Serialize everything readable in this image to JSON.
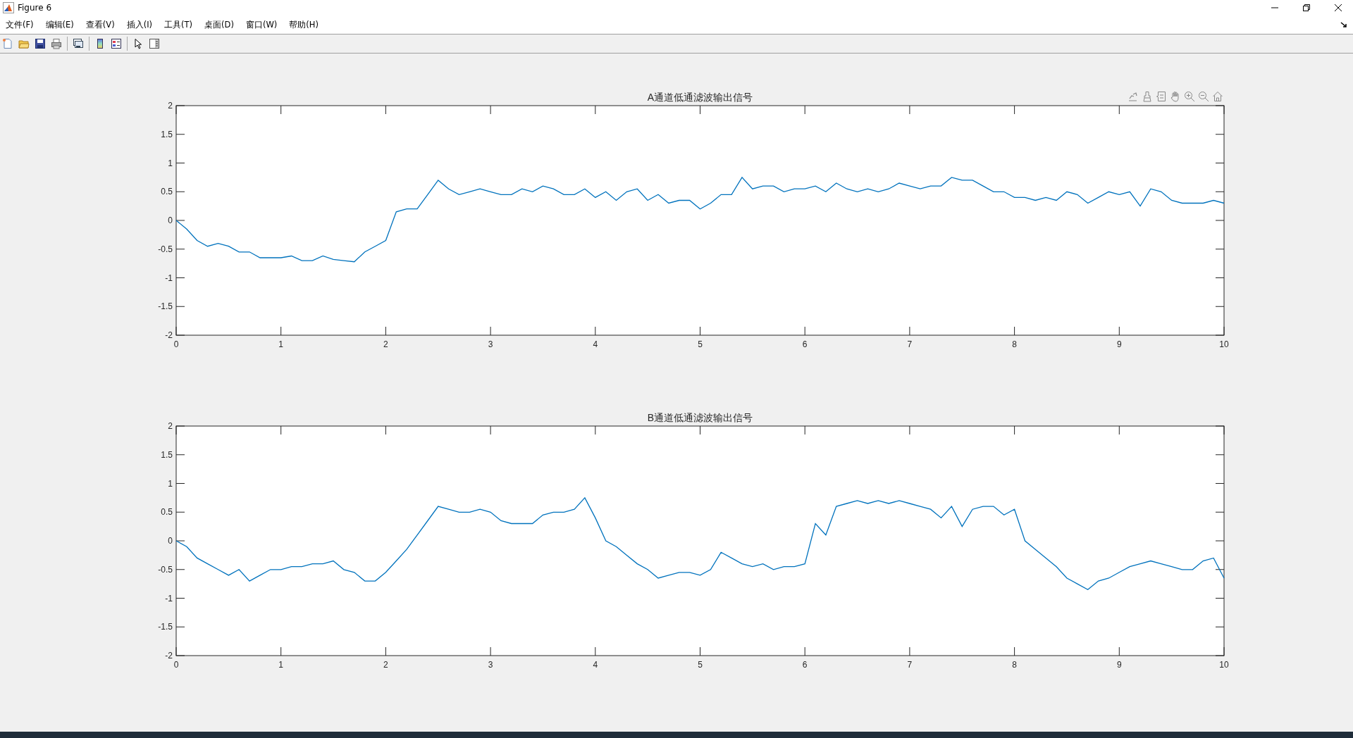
{
  "window": {
    "title": "Figure 6"
  },
  "menu": [
    {
      "label": "文件(F)"
    },
    {
      "label": "编辑(E)"
    },
    {
      "label": "查看(V)"
    },
    {
      "label": "插入(I)"
    },
    {
      "label": "工具(T)"
    },
    {
      "label": "桌面(D)"
    },
    {
      "label": "窗口(W)"
    },
    {
      "label": "帮助(H)"
    }
  ],
  "plots": [
    {
      "chart_data": {
        "type": "line",
        "title": "A通道低通滤波输出信号",
        "xlim": [
          0,
          10
        ],
        "ylim": [
          -2,
          2
        ],
        "xticks": [
          0,
          1,
          2,
          3,
          4,
          5,
          6,
          7,
          8,
          9,
          10
        ],
        "yticks": [
          -2,
          -1.5,
          -1,
          -0.5,
          0,
          0.5,
          1,
          1.5,
          2
        ],
        "x": [
          0,
          0.1,
          0.2,
          0.3,
          0.4,
          0.5,
          0.6,
          0.7,
          0.8,
          0.9,
          1,
          1.1,
          1.2,
          1.3,
          1.4,
          1.5,
          1.6,
          1.7,
          1.8,
          1.9,
          2,
          2.1,
          2.2,
          2.3,
          2.4,
          2.5,
          2.6,
          2.7,
          2.8,
          2.9,
          3,
          3.1,
          3.2,
          3.3,
          3.4,
          3.5,
          3.6,
          3.7,
          3.8,
          3.9,
          4,
          4.1,
          4.2,
          4.3,
          4.4,
          4.5,
          4.6,
          4.7,
          4.8,
          4.9,
          5,
          5.1,
          5.2,
          5.3,
          5.4,
          5.5,
          5.6,
          5.7,
          5.8,
          5.9,
          6,
          6.1,
          6.2,
          6.3,
          6.4,
          6.5,
          6.6,
          6.7,
          6.8,
          6.9,
          7,
          7.1,
          7.2,
          7.3,
          7.4,
          7.5,
          7.6,
          7.7,
          7.8,
          7.9,
          8,
          8.1,
          8.2,
          8.3,
          8.4,
          8.5,
          8.6,
          8.7,
          8.8,
          8.9,
          9,
          9.1,
          9.2,
          9.3,
          9.4,
          9.5,
          9.6,
          9.7,
          9.8,
          9.9,
          10
        ],
        "series": [
          {
            "color": "#0072bd",
            "values": [
              0,
              -0.15,
              -0.35,
              -0.45,
              -0.4,
              -0.45,
              -0.55,
              -0.55,
              -0.65,
              -0.65,
              -0.65,
              -0.62,
              -0.7,
              -0.7,
              -0.62,
              -0.68,
              -0.7,
              -0.72,
              -0.55,
              -0.45,
              -0.35,
              0.15,
              0.2,
              0.2,
              0.45,
              0.7,
              0.55,
              0.45,
              0.5,
              0.55,
              0.5,
              0.45,
              0.45,
              0.55,
              0.5,
              0.6,
              0.55,
              0.45,
              0.45,
              0.55,
              0.4,
              0.5,
              0.35,
              0.5,
              0.55,
              0.35,
              0.45,
              0.3,
              0.35,
              0.35,
              0.2,
              0.3,
              0.45,
              0.45,
              0.75,
              0.55,
              0.6,
              0.6,
              0.5,
              0.55,
              0.55,
              0.6,
              0.5,
              0.65,
              0.55,
              0.5,
              0.55,
              0.5,
              0.55,
              0.65,
              0.6,
              0.55,
              0.6,
              0.6,
              0.75,
              0.7,
              0.7,
              0.6,
              0.5,
              0.5,
              0.4,
              0.4,
              0.35,
              0.4,
              0.35,
              0.5,
              0.45,
              0.3,
              0.4,
              0.5,
              0.45,
              0.5,
              0.25,
              0.55,
              0.5,
              0.35,
              0.3,
              0.3,
              0.3,
              0.35,
              0.3
            ]
          }
        ]
      }
    },
    {
      "chart_data": {
        "type": "line",
        "title": "B通道低通滤波输出信号",
        "xlim": [
          0,
          10
        ],
        "ylim": [
          -2,
          2
        ],
        "xticks": [
          0,
          1,
          2,
          3,
          4,
          5,
          6,
          7,
          8,
          9,
          10
        ],
        "yticks": [
          -2,
          -1.5,
          -1,
          -0.5,
          0,
          0.5,
          1,
          1.5,
          2
        ],
        "x": [
          0,
          0.1,
          0.2,
          0.3,
          0.4,
          0.5,
          0.6,
          0.7,
          0.8,
          0.9,
          1,
          1.1,
          1.2,
          1.3,
          1.4,
          1.5,
          1.6,
          1.7,
          1.8,
          1.9,
          2,
          2.1,
          2.2,
          2.3,
          2.4,
          2.5,
          2.6,
          2.7,
          2.8,
          2.9,
          3,
          3.1,
          3.2,
          3.3,
          3.4,
          3.5,
          3.6,
          3.7,
          3.8,
          3.9,
          4,
          4.1,
          4.2,
          4.3,
          4.4,
          4.5,
          4.6,
          4.7,
          4.8,
          4.9,
          5,
          5.1,
          5.2,
          5.3,
          5.4,
          5.5,
          5.6,
          5.7,
          5.8,
          5.9,
          6,
          6.1,
          6.2,
          6.3,
          6.4,
          6.5,
          6.6,
          6.7,
          6.8,
          6.9,
          7,
          7.1,
          7.2,
          7.3,
          7.4,
          7.5,
          7.6,
          7.7,
          7.8,
          7.9,
          8,
          8.1,
          8.2,
          8.3,
          8.4,
          8.5,
          8.6,
          8.7,
          8.8,
          8.9,
          9,
          9.1,
          9.2,
          9.3,
          9.4,
          9.5,
          9.6,
          9.7,
          9.8,
          9.9,
          10
        ],
        "series": [
          {
            "color": "#0072bd",
            "values": [
              0,
              -0.1,
              -0.3,
              -0.4,
              -0.5,
              -0.6,
              -0.5,
              -0.7,
              -0.6,
              -0.5,
              -0.5,
              -0.45,
              -0.45,
              -0.4,
              -0.4,
              -0.35,
              -0.5,
              -0.55,
              -0.7,
              -0.7,
              -0.55,
              -0.35,
              -0.15,
              0.1,
              0.35,
              0.6,
              0.55,
              0.5,
              0.5,
              0.55,
              0.5,
              0.35,
              0.3,
              0.3,
              0.3,
              0.45,
              0.5,
              0.5,
              0.55,
              0.75,
              0.4,
              0,
              -0.1,
              -0.25,
              -0.4,
              -0.5,
              -0.65,
              -0.6,
              -0.55,
              -0.55,
              -0.6,
              -0.5,
              -0.2,
              -0.3,
              -0.4,
              -0.45,
              -0.4,
              -0.5,
              -0.45,
              -0.45,
              -0.4,
              0.3,
              0.1,
              0.6,
              0.65,
              0.7,
              0.65,
              0.7,
              0.65,
              0.7,
              0.65,
              0.6,
              0.55,
              0.4,
              0.6,
              0.25,
              0.55,
              0.6,
              0.6,
              0.45,
              0.55,
              0,
              -0.15,
              -0.3,
              -0.45,
              -0.65,
              -0.75,
              -0.85,
              -0.7,
              -0.65,
              -0.55,
              -0.45,
              -0.4,
              -0.35,
              -0.4,
              -0.45,
              -0.5,
              -0.5,
              -0.35,
              -0.3,
              -0.65
            ]
          }
        ]
      }
    }
  ]
}
